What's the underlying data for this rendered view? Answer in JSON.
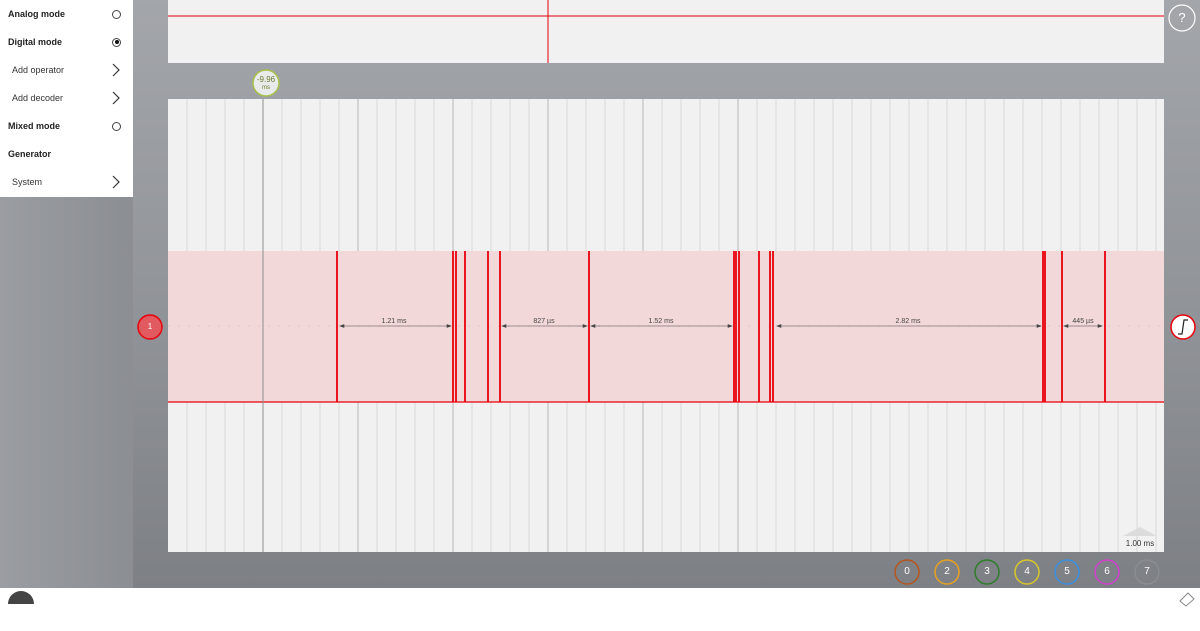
{
  "menu": {
    "items": [
      {
        "label": "Analog mode",
        "style": "bold",
        "control": "radio",
        "checked": false
      },
      {
        "label": "Digital mode",
        "style": "bold",
        "control": "radio",
        "checked": true
      },
      {
        "label": "Add operator",
        "style": "sub",
        "control": "chevron"
      },
      {
        "label": "Add decoder",
        "style": "sub",
        "control": "chevron"
      },
      {
        "label": "Mixed mode",
        "style": "bold",
        "control": "radio",
        "checked": false
      },
      {
        "label": "Generator",
        "style": "bold",
        "control": "none"
      },
      {
        "label": "System",
        "style": "sub",
        "control": "chevron"
      }
    ]
  },
  "help_label": "?",
  "cursor_marker": {
    "value": "-9.96",
    "unit": "ms"
  },
  "channel_marker": {
    "label": "1"
  },
  "measurements": [
    {
      "label": "1.21 ms"
    },
    {
      "label": "827 µs"
    },
    {
      "label": "1.52 ms"
    },
    {
      "label": "2.82 ms"
    },
    {
      "label": "445 µs"
    }
  ],
  "time_scale": "1.00 ms",
  "channel_buttons": [
    {
      "label": "0",
      "color": "#b5561f"
    },
    {
      "label": "2",
      "color": "#e8a021"
    },
    {
      "label": "3",
      "color": "#2f7d2a"
    },
    {
      "label": "4",
      "color": "#d8c62a"
    },
    {
      "label": "5",
      "color": "#3b8fe0"
    },
    {
      "label": "6",
      "color": "#d23fd0"
    },
    {
      "label": "7",
      "color": "#8a8d92"
    }
  ],
  "colors": {
    "signal": "#e8000b",
    "band": "#f3d8d9",
    "plot_bg": "#f1f1f1",
    "grid": "#d4d4d4"
  }
}
